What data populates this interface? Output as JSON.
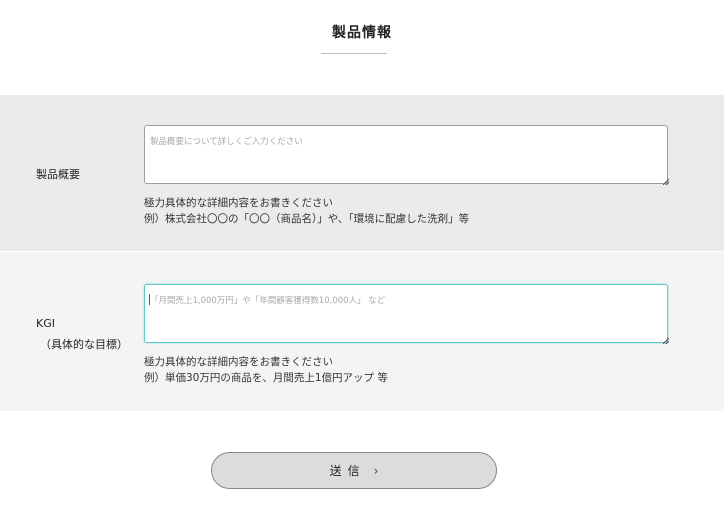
{
  "header": {
    "title": "製品情報"
  },
  "product_overview": {
    "label": "製品概要",
    "placeholder": "製品概要について詳しくご入力ください",
    "hint_line1": "極力具体的な詳細内容をお書きください",
    "hint_line2": "例）株式会社〇〇の「〇〇（商品名）」や、「環境に配慮した洗剤」等"
  },
  "kgi": {
    "label": "KGI",
    "label_sub": "（具体的な目標）",
    "placeholder": "「月間売上1,000万円」や「年間顧客獲得数10,000人」 など",
    "hint_line1": "極力具体的な詳細内容をお書きください",
    "hint_line2": "例）単価30万円の商品を、月間売上1億円アップ 等"
  },
  "submit": {
    "label": "送信",
    "chevron": "›",
    "icon": "chevron-right-icon"
  }
}
